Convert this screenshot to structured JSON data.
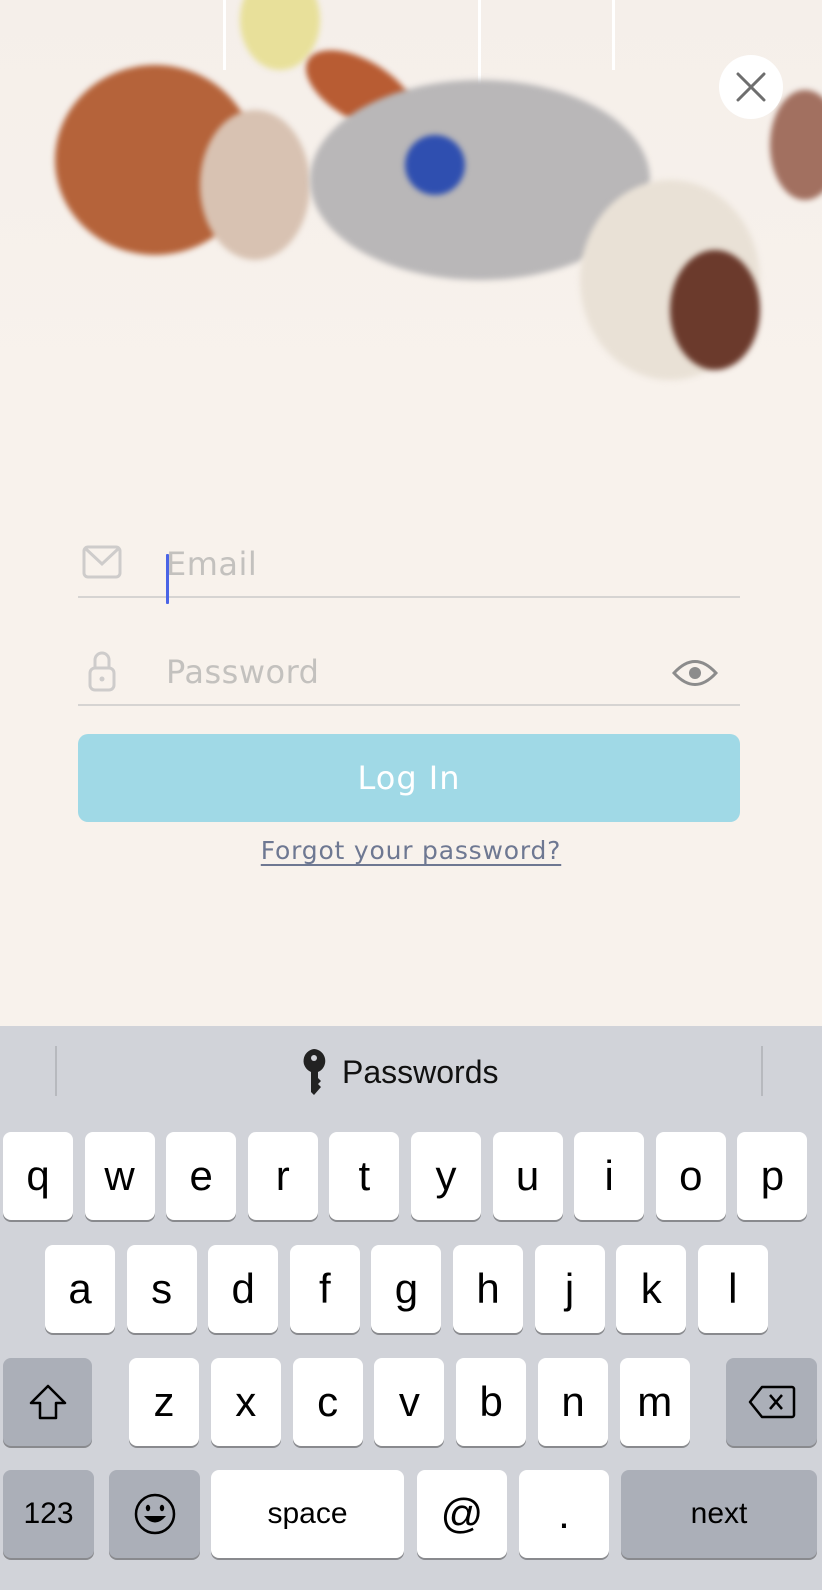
{
  "hero": {
    "image_alt": "Plush animal baby mobile"
  },
  "close_button": {
    "icon": "close-icon"
  },
  "form": {
    "email": {
      "placeholder": "Email",
      "value": "",
      "icon": "envelope-icon",
      "focused": true
    },
    "password": {
      "placeholder": "Password",
      "value": "",
      "icon": "lock-icon",
      "toggle_icon": "eye-icon"
    },
    "login_label": "Log In",
    "forgot_label": "Forgot your password?"
  },
  "colors": {
    "background": "#f8f2ec",
    "login_button": "#a0d9e6",
    "link": "#6e7892",
    "caret": "#4a64e6",
    "keyboard": "#d1d3d9"
  },
  "keyboard": {
    "suggestion": {
      "icon": "key-icon",
      "label": "Passwords"
    },
    "row1": [
      "q",
      "w",
      "e",
      "r",
      "t",
      "y",
      "u",
      "i",
      "o",
      "p"
    ],
    "row2": [
      "a",
      "s",
      "d",
      "f",
      "g",
      "h",
      "j",
      "k",
      "l"
    ],
    "row3": [
      "z",
      "x",
      "c",
      "v",
      "b",
      "n",
      "m"
    ],
    "shift_icon": "shift-icon",
    "delete_icon": "delete-icon",
    "numbers_label": "123",
    "emoji_icon": "emoji-icon",
    "space_label": "space",
    "at_label": "@",
    "dot_label": ".",
    "return_label": "next"
  }
}
